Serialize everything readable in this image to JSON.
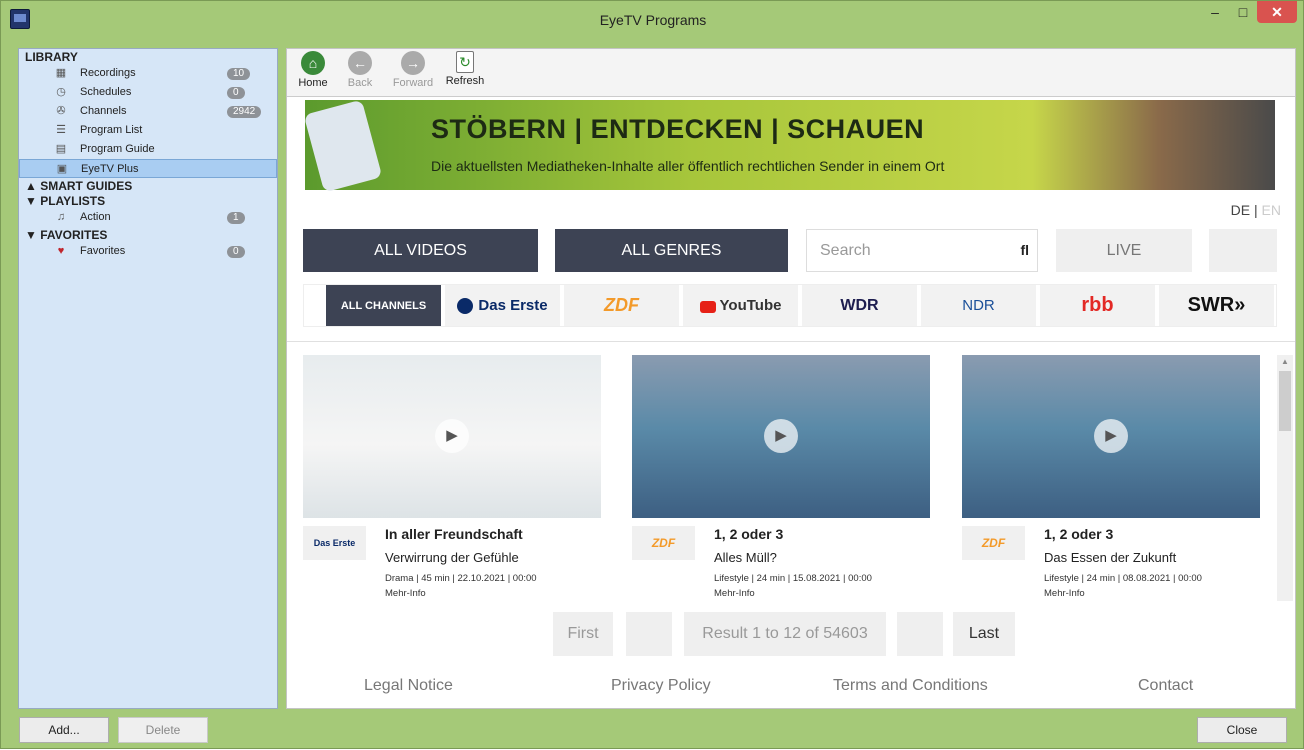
{
  "window": {
    "title": "EyeTV Programs",
    "min": "–",
    "max": "□",
    "close": "✕"
  },
  "sidebar": {
    "library_header": "LIBRARY",
    "library_items": [
      {
        "label": "Recordings",
        "badge": "10",
        "icon": "film-icon"
      },
      {
        "label": "Schedules",
        "badge": "0",
        "icon": "clock-icon"
      },
      {
        "label": "Channels",
        "badge": "2942",
        "icon": "satellite-icon"
      },
      {
        "label": "Program List",
        "badge": "",
        "icon": "list-icon"
      },
      {
        "label": "Program Guide",
        "badge": "",
        "icon": "grid-icon"
      },
      {
        "label": "EyeTV Plus",
        "badge": "",
        "icon": "eyetv-plus-icon"
      }
    ],
    "smart_guides_header": "▲ SMART GUIDES",
    "playlists_header": "▼ PLAYLISTS",
    "playlist_items": [
      {
        "label": "Action",
        "badge": "1"
      }
    ],
    "favorites_header": "▼ FAVORITES",
    "favorite_items": [
      {
        "label": "Favorites",
        "badge": "0"
      }
    ]
  },
  "toolbar": {
    "home": "Home",
    "back": "Back",
    "forward": "Forward",
    "refresh": "Refresh"
  },
  "banner": {
    "headline": "STÖBERN | ENTDECKEN | SCHAUEN",
    "subline": "Die aktuellsten Mediatheken-Inhalte aller öffentlich rechtlichen Sender in einem Ort"
  },
  "lang": {
    "de": "DE",
    "sep": " | ",
    "en": "EN"
  },
  "nav": {
    "all_videos": "ALL VIDEOS",
    "all_genres": "ALL GENRES",
    "search_placeholder": "Search",
    "search_icon": "fl",
    "live": "LIVE"
  },
  "channels": [
    "ALL CHANNELS",
    "Das Erste",
    "ZDF",
    "YouTube",
    "WDR",
    "NDR",
    "rbb",
    "SWR»"
  ],
  "cards": [
    {
      "channel": "Das Erste",
      "title": "In aller Freundschaft",
      "subtitle": "Verwirrung der Gefühle",
      "meta": "Drama | 45 min | 22.10.2021 | 00:00",
      "more": "Mehr-Info"
    },
    {
      "channel": "ZDF",
      "title": "1, 2 oder 3",
      "subtitle": "Alles Müll?",
      "meta": "Lifestyle | 24 min | 15.08.2021 | 00:00",
      "more": "Mehr-Info"
    },
    {
      "channel": "ZDF",
      "title": "1, 2 oder 3",
      "subtitle": "Das Essen der Zukunft",
      "meta": "Lifestyle | 24 min | 08.08.2021 | 00:00",
      "more": "Mehr-Info"
    }
  ],
  "pager": {
    "first": "First",
    "result": "Result 1 to 12 of 54603",
    "last": "Last"
  },
  "footer": {
    "legal": "Legal Notice",
    "privacy": "Privacy Policy",
    "terms": "Terms and Conditions",
    "contact": "Contact"
  },
  "bottom": {
    "add": "Add...",
    "delete": "Delete",
    "close": "Close"
  }
}
